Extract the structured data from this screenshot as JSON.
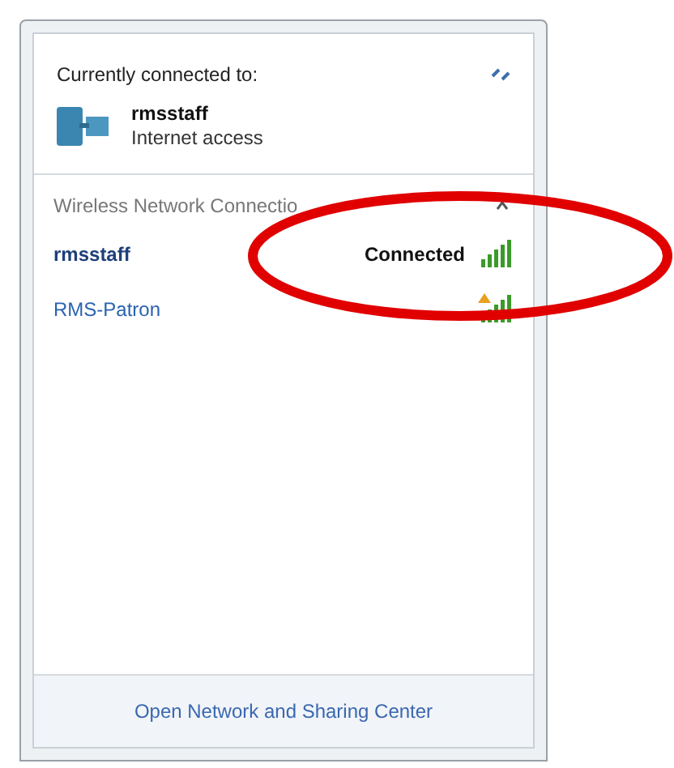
{
  "current": {
    "heading": "Currently connected to:",
    "network": "rmsstaff",
    "access": "Internet access"
  },
  "section": {
    "title": "Wireless Network Connectio",
    "expanded": true
  },
  "networks": [
    {
      "name": "rmsstaff",
      "status": "Connected",
      "connected": true,
      "warning": false
    },
    {
      "name": "RMS-Patron",
      "connected": false,
      "warning": true
    }
  ],
  "footer": {
    "link": "Open Network and Sharing Center"
  }
}
